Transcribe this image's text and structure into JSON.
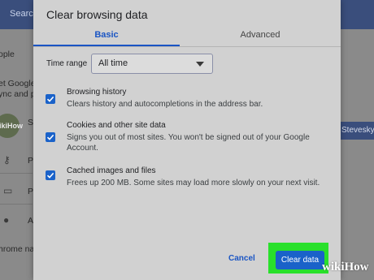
{
  "background": {
    "search_text": "Search",
    "texts": [
      "ople",
      "et Google",
      "ync and p",
      "S",
      "P",
      "P",
      "A",
      "hrome na"
    ],
    "avatar_text": "vikiHow",
    "account_button": "Stevesky"
  },
  "dialog": {
    "title": "Clear browsing data",
    "tabs": [
      {
        "label": "Basic",
        "active": true
      },
      {
        "label": "Advanced",
        "active": false
      }
    ],
    "time_range": {
      "label": "Time range",
      "value": "All time"
    },
    "options": [
      {
        "title": "Browsing history",
        "description": "Clears history and autocompletions in the address bar.",
        "checked": true
      },
      {
        "title": "Cookies and other site data",
        "description": "Signs you out of most sites. You won't be signed out of your Google Account.",
        "checked": true
      },
      {
        "title": "Cached images and files",
        "description": "Frees up 200 MB. Some sites may load more slowly on your next visit.",
        "checked": true
      }
    ],
    "buttons": {
      "cancel": "Cancel",
      "clear": "Clear data"
    }
  },
  "watermark": "wikiHow",
  "colors": {
    "accent": "#1a62c9",
    "highlight": "#29e02b",
    "header": "#3a4e7c"
  },
  "icons": [
    "check-icon",
    "caret-down-icon",
    "key-icon",
    "card-icon",
    "location-icon"
  ]
}
